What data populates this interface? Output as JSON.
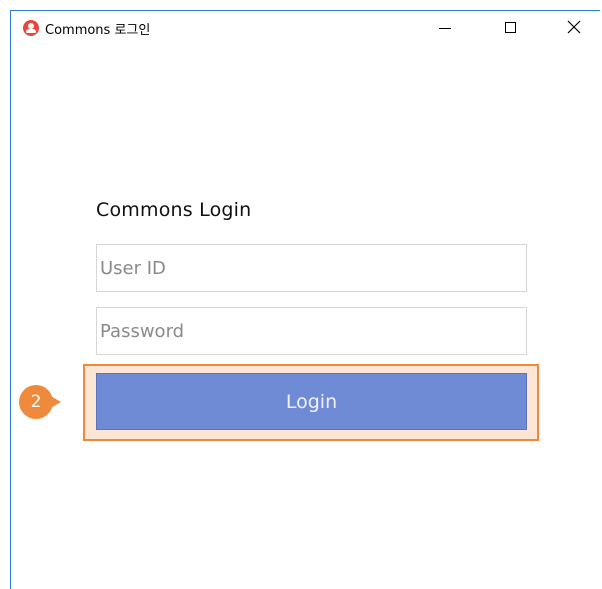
{
  "window": {
    "title": "Commons 로그인",
    "icon": "commons-user-icon",
    "controls": {
      "minimize_icon": "minimize-icon",
      "maximize_icon": "maximize-icon",
      "close_icon": "close-icon",
      "close_glyph": "✕"
    }
  },
  "login": {
    "heading": "Commons Login",
    "user_id_placeholder": "User ID",
    "password_placeholder": "Password",
    "button_label": "Login"
  },
  "annotation": {
    "step_number": "2",
    "highlight_color": "#f0893b"
  },
  "colors": {
    "accent": "#6f8bd6",
    "app_icon": "#e8453c",
    "window_border": "#2b7fd0"
  }
}
